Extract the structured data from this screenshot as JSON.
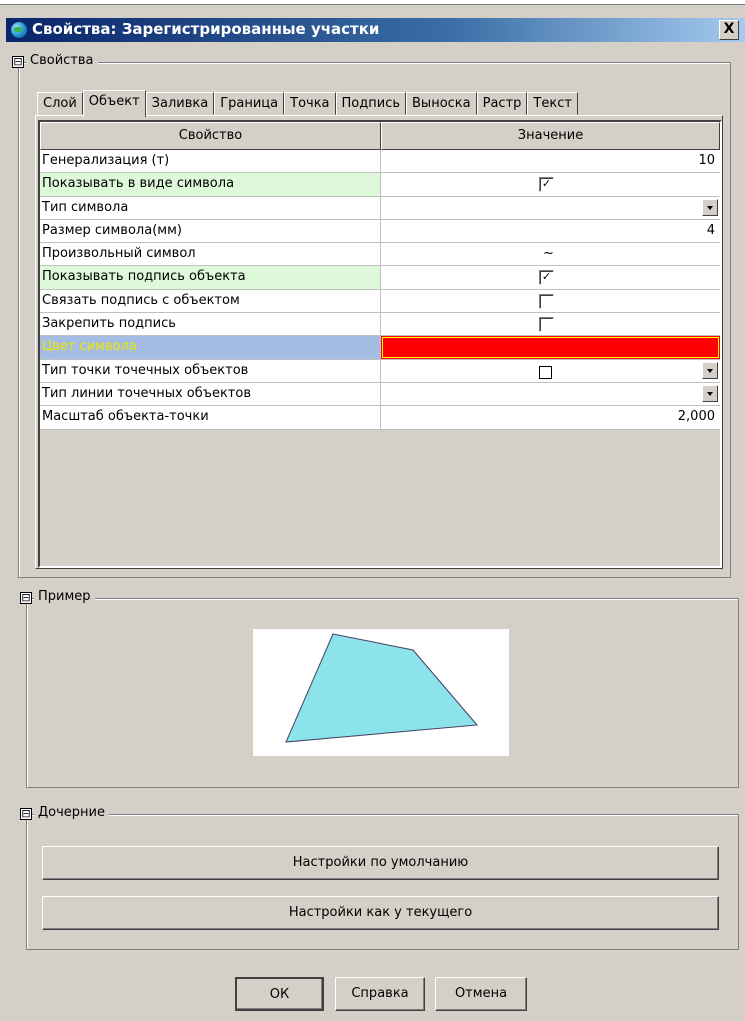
{
  "window": {
    "title": "Свойства: Зарегистрированные участки",
    "close_label": "X"
  },
  "groups": {
    "properties": {
      "toggle": "⊟",
      "label": "Свойства"
    },
    "example": {
      "toggle": "⊟",
      "label": "Пример"
    },
    "children": {
      "toggle": "⊟",
      "label": "Дочерние"
    }
  },
  "tabs": [
    "Слой",
    "Объект",
    "Заливка",
    "Граница",
    "Точка",
    "Подпись",
    "Выноска",
    "Растр",
    "Текст"
  ],
  "active_tab": "Объект",
  "grid": {
    "col_property": "Свойство",
    "col_value": "Значение",
    "rows": [
      {
        "name": "Генерализация (т)",
        "value": "10"
      },
      {
        "name": "Показывать в виде символа",
        "value": "✓"
      },
      {
        "name": "Тип символа",
        "value": ""
      },
      {
        "name": "Размер символа(мм)",
        "value": "4"
      },
      {
        "name": "Произвольный символ",
        "value": "~"
      },
      {
        "name": "Показывать подпись объекта",
        "value": "✓"
      },
      {
        "name": "Связать подпись с объектом",
        "value": ""
      },
      {
        "name": "Закрепить подпись",
        "value": ""
      },
      {
        "name": "Цвет символа",
        "value": ""
      },
      {
        "name": "Тип точки точечных объектов",
        "value": ""
      },
      {
        "name": "Тип линии точечных объектов",
        "value": ""
      },
      {
        "name": "Масштаб объекта-точки",
        "value": "2,000"
      }
    ],
    "symbol_color": "#ff0000",
    "highlight_color": "#ddf9d9",
    "selected_row_color": "#a6bde3"
  },
  "example": {
    "polygon_fill": "#8ce3ea",
    "polygon_stroke": "#404060"
  },
  "children": {
    "default_button": "Настройки по умолчанию",
    "current_button": "Настройки как у текущего"
  },
  "buttons": {
    "ok": "ОК",
    "help": "Справка",
    "cancel": "Отмена"
  }
}
